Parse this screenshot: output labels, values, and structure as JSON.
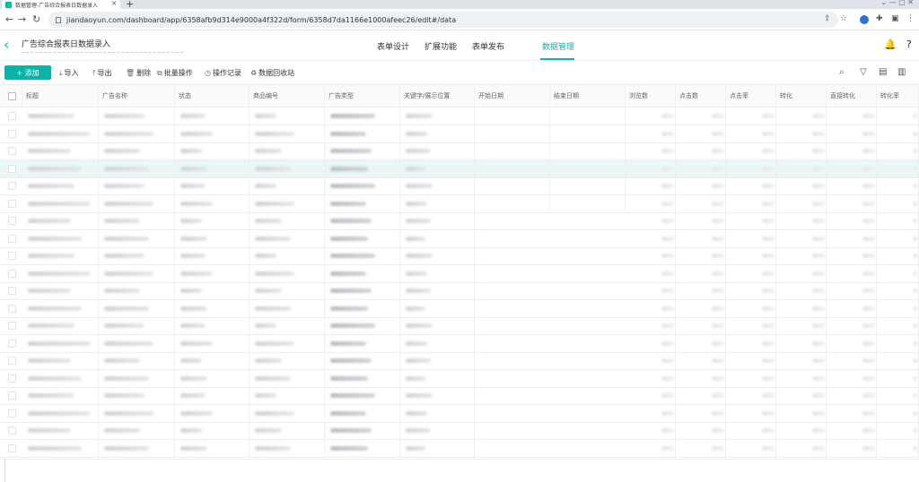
{
  "browser": {
    "tab_title": "数据管理-广告综合报表日数据录入",
    "tab_close": "✕",
    "new_tab": "+",
    "url": "jiandaoyun.com/dashboard/app/6358afb9d314e9000a4f322d/form/6358d7da1166e1000afeec26/edit#/data"
  },
  "app": {
    "form_name": "广告综合报表日数据录入",
    "nav_tabs": [
      "表单设计",
      "扩展功能",
      "表单发布",
      "数据管理"
    ],
    "active_tab": "数据管理"
  },
  "toolbar": {
    "add": "+ 添加",
    "import": "导入",
    "export": "导出",
    "delete": "删除",
    "batch": "批量操作",
    "log": "操作记录",
    "recycle": "数据回收站"
  },
  "table": {
    "columns": [
      "标题",
      "广告名称",
      "状态",
      "商品编号",
      "广告类型",
      "关键字/展示位置",
      "开始日期",
      "结束日期",
      "浏览数",
      "点击数",
      "点击率",
      "转化",
      "直接转化",
      "转化率"
    ],
    "row_count": 20,
    "highlight_row": 3
  },
  "colors": {
    "accent": "#0db3a6",
    "highlight_row": "#eaf7f6"
  }
}
